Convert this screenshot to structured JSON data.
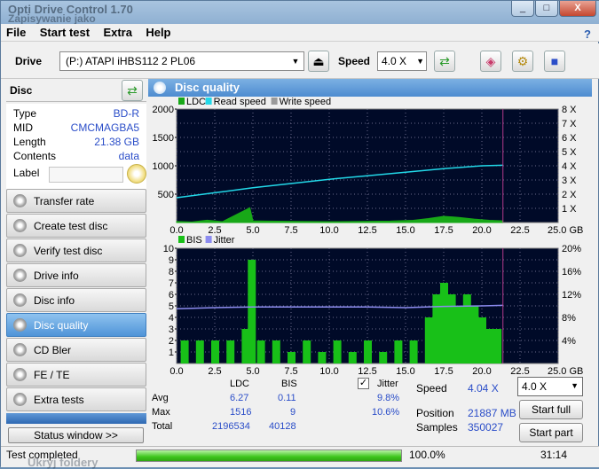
{
  "window": {
    "title": "Opti Drive Control 1.70",
    "subtitle": "Zapisywanie jako",
    "controls": [
      "_",
      "□",
      "X"
    ]
  },
  "menu": {
    "items": [
      "File",
      "Start test",
      "Extra",
      "Help"
    ]
  },
  "toolbar": {
    "drive_label": "Drive",
    "drive_value": "(P:)  ATAPI iHBS112  2 PL06",
    "speed_label": "Speed",
    "speed_value": "4.0 X"
  },
  "disc": {
    "header": "Disc",
    "rows": [
      {
        "key": "Type",
        "value": "BD-R"
      },
      {
        "key": "MID",
        "value": "CMCMAGBA5"
      },
      {
        "key": "Length",
        "value": "21.38 GB"
      },
      {
        "key": "Contents",
        "value": "data"
      }
    ],
    "label_key": "Label"
  },
  "nav": {
    "items": [
      "Transfer rate",
      "Create test disc",
      "Verify test disc",
      "Drive info",
      "Disc info",
      "Disc quality",
      "CD Bler",
      "FE / TE",
      "Extra tests"
    ],
    "active": "Disc quality",
    "status_button": "Status window >>"
  },
  "panel": {
    "title": "Disc quality"
  },
  "chart_data": [
    {
      "type": "area",
      "title": "",
      "legend": [
        "LDC",
        "Read speed",
        "Write speed"
      ],
      "colors": {
        "LDC": "#18a818",
        "Read speed": "#22d8e8",
        "Write speed": "#9a9a9a"
      },
      "x_ticks": [
        "0.0",
        "2.5",
        "5.0",
        "7.5",
        "10.0",
        "12.5",
        "15.0",
        "17.5",
        "20.0",
        "22.5",
        "25.0 GB"
      ],
      "y_left_ticks": [
        "500",
        "1000",
        "1500",
        "2000"
      ],
      "y_right_ticks": [
        "1 X",
        "2 X",
        "3 X",
        "4 X",
        "5 X",
        "6 X",
        "7 X",
        "8 X"
      ],
      "xlim": [
        0,
        25
      ],
      "ylim": [
        0,
        2000
      ],
      "y2lim": [
        0,
        8
      ],
      "series": [
        {
          "name": "Read speed",
          "axis": "right",
          "x": [
            0,
            2.5,
            5,
            7.5,
            10,
            12.5,
            15,
            17.5,
            20,
            21.38
          ],
          "y": [
            1.75,
            2.1,
            2.45,
            2.75,
            3.05,
            3.3,
            3.55,
            3.8,
            4.0,
            4.04
          ]
        },
        {
          "name": "LDC",
          "axis": "left",
          "x": [
            0,
            1,
            2,
            3,
            4.8,
            5.0,
            6,
            8,
            10,
            12,
            14,
            15.5,
            16.5,
            17.5,
            18.5,
            19.5,
            20.5,
            21.38
          ],
          "y": [
            20,
            10,
            40,
            15,
            260,
            30,
            25,
            20,
            15,
            20,
            25,
            40,
            70,
            110,
            90,
            60,
            40,
            30
          ]
        }
      ],
      "marker_x": 21.38
    },
    {
      "type": "bar",
      "title": "",
      "legend": [
        "BIS",
        "Jitter"
      ],
      "colors": {
        "BIS": "#18c018",
        "Jitter": "#8c8cf0"
      },
      "x_ticks": [
        "0.0",
        "2.5",
        "5.0",
        "7.5",
        "10.0",
        "12.5",
        "15.0",
        "17.5",
        "20.0",
        "22.5",
        "25.0 GB"
      ],
      "y_left_ticks": [
        "1",
        "2",
        "3",
        "4",
        "5",
        "6",
        "7",
        "8",
        "9",
        "10"
      ],
      "y_right_ticks": [
        "4%",
        "8%",
        "12%",
        "16%",
        "20%"
      ],
      "xlim": [
        0,
        25
      ],
      "ylim": [
        0,
        10
      ],
      "y2lim": [
        0,
        20
      ],
      "series": [
        {
          "name": "BIS",
          "axis": "left",
          "x": [
            0.5,
            1.5,
            2.5,
            3.5,
            4.5,
            4.9,
            5.5,
            6.5,
            7.5,
            8.5,
            9.5,
            10.5,
            11.5,
            12.5,
            13.5,
            14.5,
            15.5,
            16.5,
            17.0,
            17.5,
            18.0,
            18.5,
            19.0,
            19.5,
            20.0,
            20.5,
            21.0
          ],
          "y": [
            2,
            2,
            2,
            2,
            3,
            9,
            2,
            2,
            1,
            2,
            1,
            2,
            1,
            2,
            1,
            2,
            2,
            4,
            6,
            7,
            6,
            5,
            6,
            5,
            4,
            3,
            3
          ]
        },
        {
          "name": "Jitter",
          "axis": "right",
          "x": [
            0,
            2.5,
            5,
            7.5,
            10,
            12.5,
            15,
            17.5,
            20,
            21.38
          ],
          "y": [
            9.5,
            9.7,
            9.8,
            9.8,
            9.8,
            9.8,
            9.7,
            9.9,
            10.0,
            10.1
          ]
        }
      ],
      "marker_x": 21.38
    }
  ],
  "stats": {
    "col_ldc": "LDC",
    "col_bis": "BIS",
    "jitter_label": "Jitter",
    "jitter_checked": true,
    "rows": [
      {
        "label": "Avg",
        "ldc": "6.27",
        "bis": "0.11",
        "jitter": "9.8%"
      },
      {
        "label": "Max",
        "ldc": "1516",
        "bis": "9",
        "jitter": "10.6%"
      },
      {
        "label": "Total",
        "ldc": "2196534",
        "bis": "40128",
        "jitter": ""
      }
    ],
    "speed_label": "Speed",
    "speed_value": "4.04 X",
    "position_label": "Position",
    "position_value": "21887 MB",
    "samples_label": "Samples",
    "samples_value": "350027",
    "speed_select": "4.0 X",
    "start_full": "Start full",
    "start_part": "Start part"
  },
  "statusbar": {
    "text": "Test completed",
    "progress": 1.0,
    "percent": "100.0%",
    "time": "31:14"
  },
  "background_text": "Ukryj foldery"
}
